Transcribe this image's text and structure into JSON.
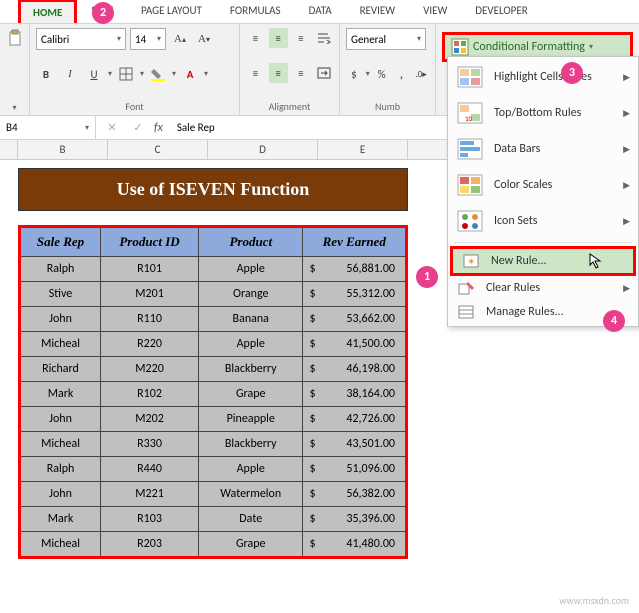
{
  "tabs": [
    "HOME",
    "SERT",
    "PAGE LAYOUT",
    "FORMULAS",
    "DATA",
    "REVIEW",
    "VIEW",
    "DEVELOPER"
  ],
  "font": {
    "name": "Calibri",
    "size": "14"
  },
  "number_format": "General",
  "group_labels": {
    "font": "Font",
    "alignment": "Alignment",
    "number": "Numb"
  },
  "cf_button": "Conditional Formatting",
  "cf_menu": {
    "highlight": "Highlight Cells Rules",
    "topbottom": "Top/Bottom Rules",
    "databars": "Data Bars",
    "colorscales": "Color Scales",
    "iconsets": "Icon Sets",
    "newrule": "New Rule...",
    "clear": "Clear Rules",
    "manage": "Manage Rules..."
  },
  "name_box": "B4",
  "formula": "Sale Rep",
  "columns": [
    "B",
    "C",
    "D",
    "E"
  ],
  "title": "Use of ISEVEN Function",
  "headers": [
    "Sale Rep",
    "Product ID",
    "Product",
    "Rev Earned"
  ],
  "rows": [
    {
      "rep": "Ralph",
      "pid": "R101",
      "prod": "Apple",
      "rev": "56,881.00"
    },
    {
      "rep": "Stive",
      "pid": "M201",
      "prod": "Orange",
      "rev": "55,312.00"
    },
    {
      "rep": "John",
      "pid": "R110",
      "prod": "Banana",
      "rev": "53,662.00"
    },
    {
      "rep": "Micheal",
      "pid": "R220",
      "prod": "Apple",
      "rev": "41,500.00"
    },
    {
      "rep": "Richard",
      "pid": "M220",
      "prod": "Blackberry",
      "rev": "46,198.00"
    },
    {
      "rep": "Mark",
      "pid": "R102",
      "prod": "Grape",
      "rev": "38,164.00"
    },
    {
      "rep": "John",
      "pid": "M202",
      "prod": "Pineapple",
      "rev": "42,726.00"
    },
    {
      "rep": "Micheal",
      "pid": "R330",
      "prod": "Blackberry",
      "rev": "43,501.00"
    },
    {
      "rep": "Ralph",
      "pid": "R440",
      "prod": "Apple",
      "rev": "51,096.00"
    },
    {
      "rep": "John",
      "pid": "M221",
      "prod": "Watermelon",
      "rev": "56,382.00"
    },
    {
      "rep": "Mark",
      "pid": "R103",
      "prod": "Date",
      "rev": "35,396.00"
    },
    {
      "rep": "Micheal",
      "pid": "R203",
      "prod": "Grape",
      "rev": "41,480.00"
    }
  ],
  "steps": {
    "1": "1",
    "2": "2",
    "3": "3",
    "4": "4"
  },
  "watermark": "www.msxdn.com"
}
